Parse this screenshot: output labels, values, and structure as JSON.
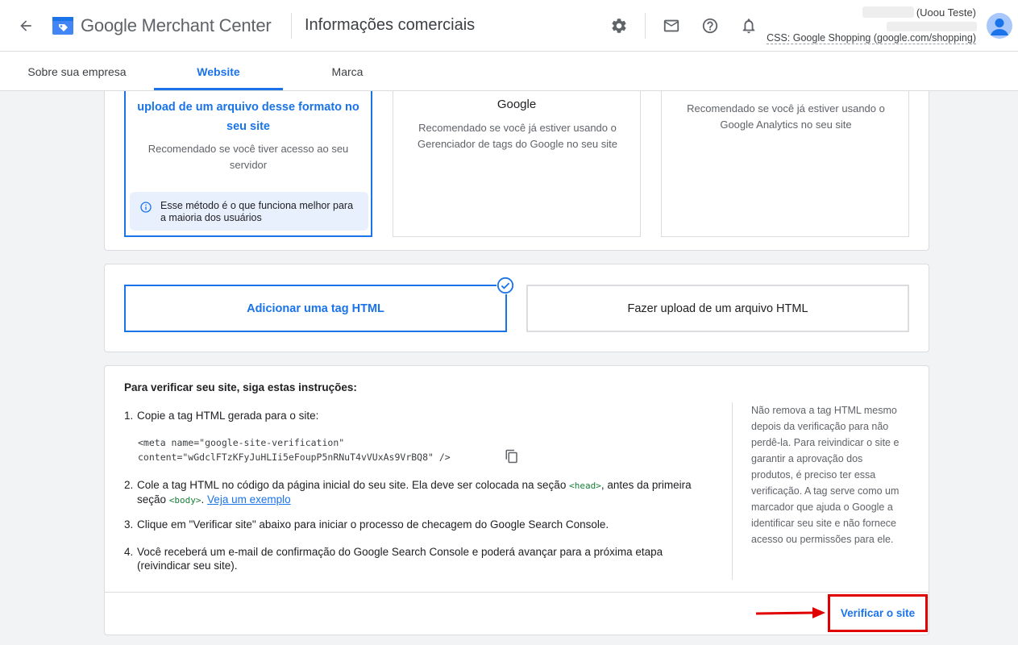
{
  "header": {
    "logo_text": "Google Merchant Center",
    "page_title": "Informações comerciais",
    "account_name": "(Uoou Teste)",
    "css_label": "CSS: Google Shopping (google.com/shopping)"
  },
  "tabs": [
    {
      "label": "Sobre sua empresa",
      "active": false
    },
    {
      "label": "Website",
      "active": true
    },
    {
      "label": "Marca",
      "active": false
    }
  ],
  "methods": {
    "upload_file": {
      "title": "upload de um arquivo desse formato no seu site",
      "description": "Recomendado se você tiver acesso ao seu servidor",
      "info": "Esse método é o que funciona melhor para a maioria dos usuários",
      "selected": true
    },
    "tag_manager": {
      "title": "Google",
      "description": "Recomendado se você já estiver usando o Gerenciador de tags do Google no seu site"
    },
    "analytics": {
      "description": "Recomendado se você já estiver usando o Google Analytics no seu site"
    }
  },
  "options": {
    "html_tag": "Adicionar uma tag HTML",
    "html_file": "Fazer upload de um arquivo HTML",
    "selected": "html_tag"
  },
  "instructions": {
    "title": "Para verificar seu site, siga estas instruções:",
    "step1": "Copie a tag HTML gerada para o site:",
    "code_line1": "<meta name=\"google-site-verification\"",
    "code_line2": "content=\"wGdclFTzKFyJuHLIi5eFoupP5nRNuT4vVUxAs9VrBQ8\" />",
    "step2_a": "Cole a tag HTML no código da página inicial do seu site. Ela deve ser colocada na seção ",
    "step2_head": "<head>",
    "step2_b": ", antes da primeira",
    "step2_c": "seção ",
    "step2_body": "<body>",
    "step2_d": ". ",
    "step2_link": "Veja um exemplo",
    "step3": "Clique em \"Verificar site\" abaixo para iniciar o processo de checagem do Google Search Console.",
    "step4_a": "Você receberá um e-mail de confirmação do Google Search Console e poderá avançar para a próxima etapa",
    "step4_b": "(reivindicar seu site).",
    "side_note": "Não remova a tag HTML mesmo depois da verificação para não perdê-la. Para reivindicar o site e garantir a aprovação dos produtos, é preciso ter essa verificação. A tag serve como um marcador que ajuda o Google a identificar seu site e não fornece acesso ou permissões para ele.",
    "verify_button": "Verificar o site"
  },
  "colors": {
    "accent": "#1a73e8",
    "highlight": "#e00000",
    "code_tag": "#188038"
  }
}
